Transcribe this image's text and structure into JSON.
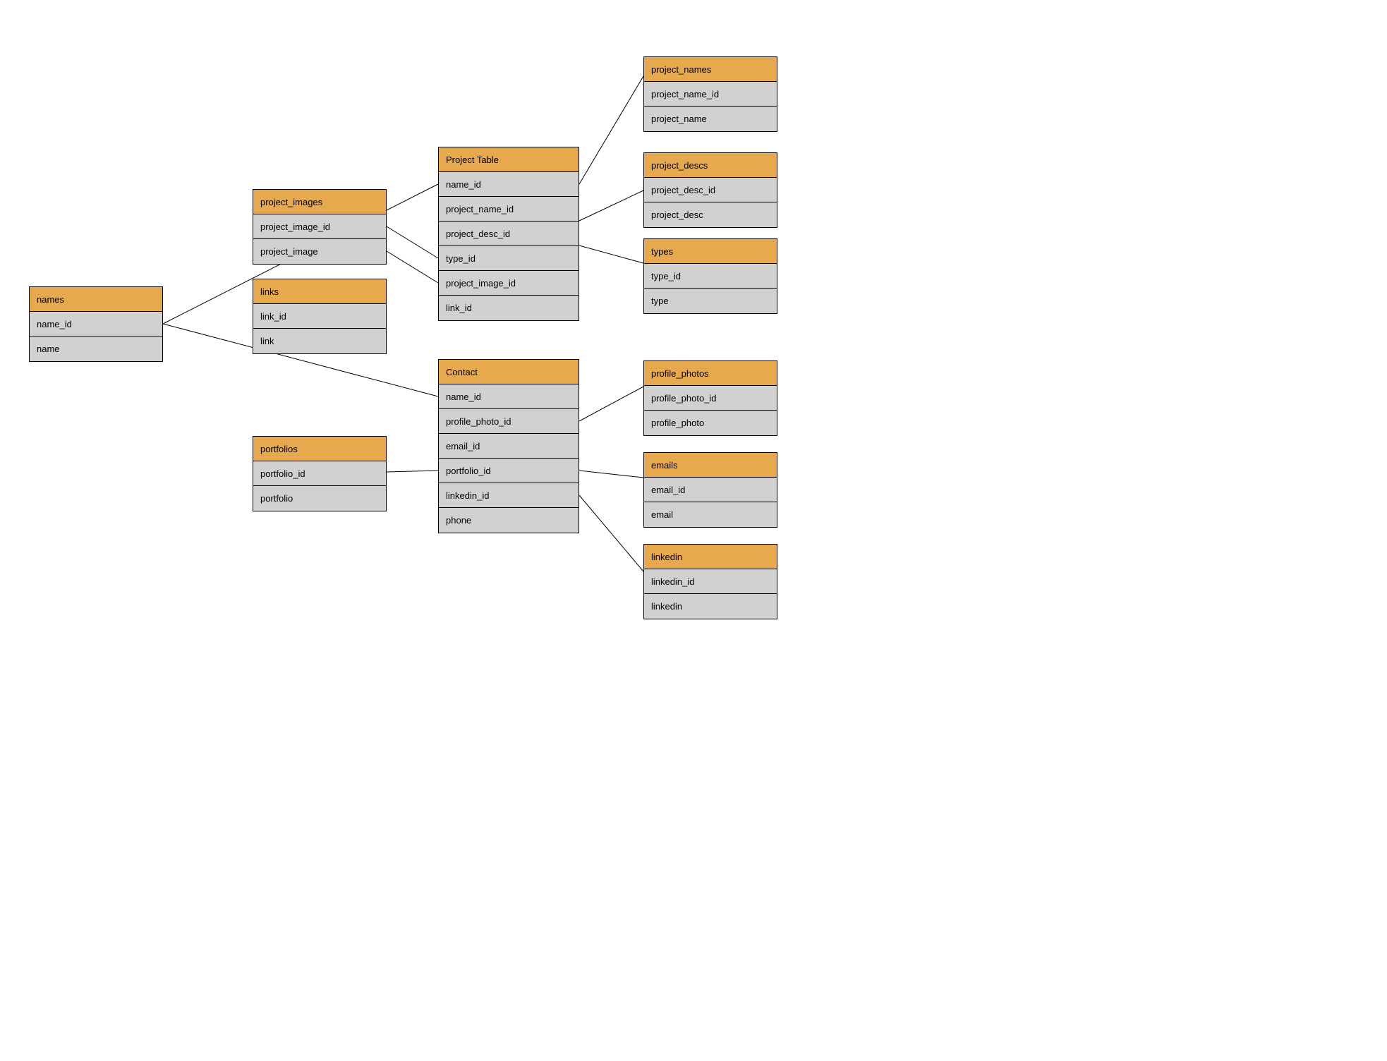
{
  "tables": {
    "names": {
      "title": "names",
      "fields": [
        "name_id",
        "name"
      ]
    },
    "project_images": {
      "title": "project_images",
      "fields": [
        "project_image_id",
        "project_image"
      ]
    },
    "links": {
      "title": "links",
      "fields": [
        "link_id",
        "link"
      ]
    },
    "project_table": {
      "title": "Project Table",
      "fields": [
        "name_id",
        "project_name_id",
        "project_desc_id",
        "type_id",
        "project_image_id",
        "link_id"
      ]
    },
    "project_names": {
      "title": "project_names",
      "fields": [
        "project_name_id",
        "project_name"
      ]
    },
    "project_descs": {
      "title": "project_descs",
      "fields": [
        "project_desc_id",
        "project_desc"
      ]
    },
    "types": {
      "title": "types",
      "fields": [
        "type_id",
        "type"
      ]
    },
    "contact": {
      "title": "Contact",
      "fields": [
        "name_id",
        "profile_photo_id",
        "email_id",
        "portfolio_id",
        "linkedin_id",
        "phone"
      ]
    },
    "portfolios": {
      "title": "portfolios",
      "fields": [
        "portfolio_id",
        "portfolio"
      ]
    },
    "profile_photos": {
      "title": "profile_photos",
      "fields": [
        "profile_photo_id",
        "profile_photo"
      ]
    },
    "emails": {
      "title": "emails",
      "fields": [
        "email_id",
        "email"
      ]
    },
    "linkedin": {
      "title": "linkedin",
      "fields": [
        "linkedin_id",
        "linkedin"
      ]
    }
  },
  "colors": {
    "header": "#e6a94e",
    "body": "#d1d1d1",
    "border": "#000000"
  }
}
